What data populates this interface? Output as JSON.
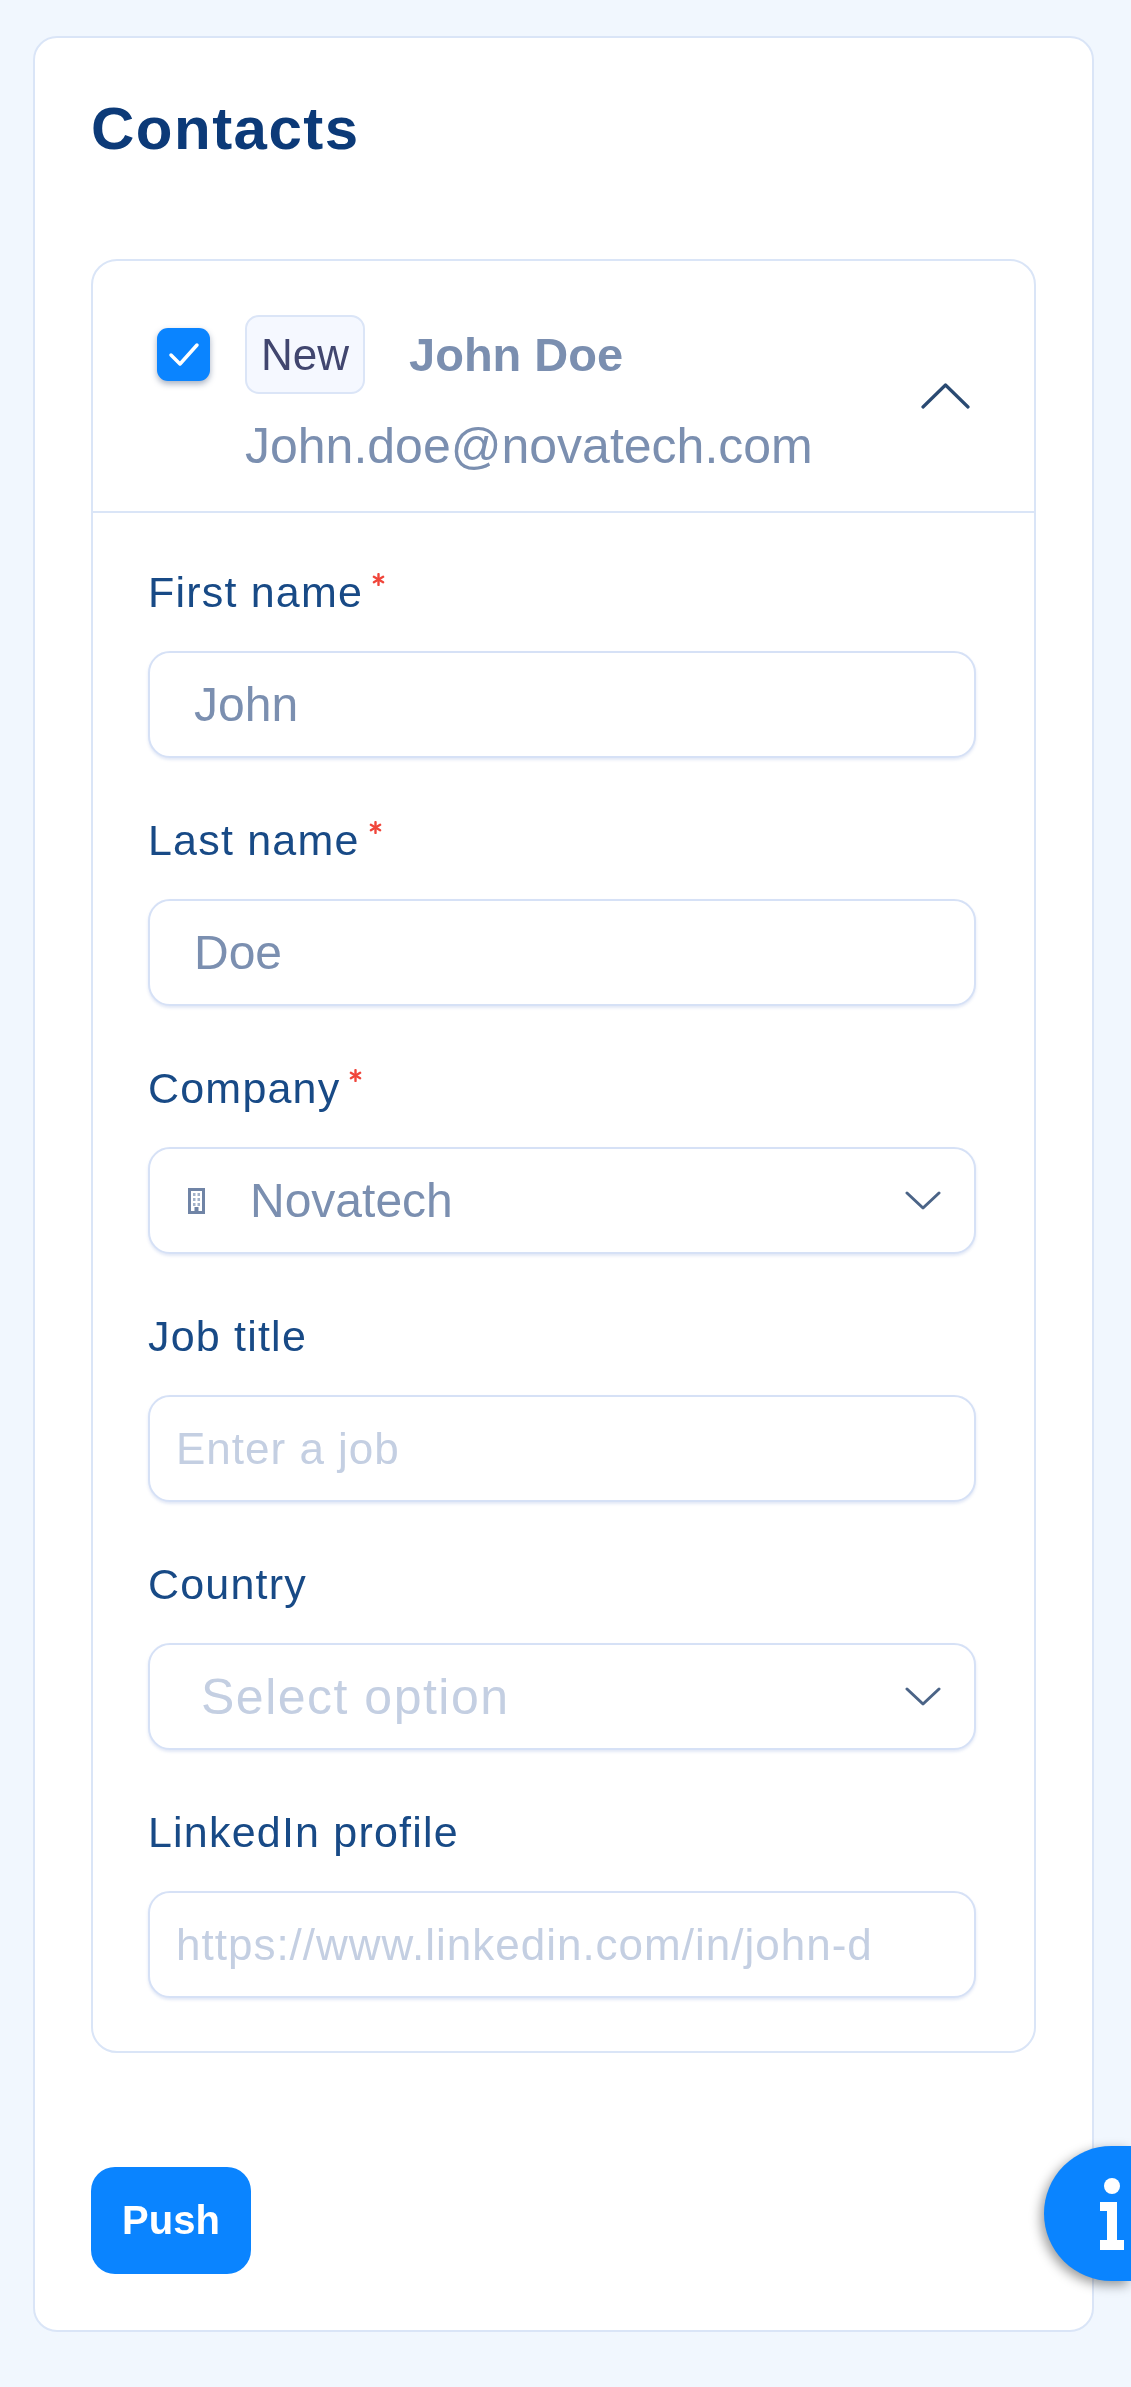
{
  "panel": {
    "title": "Contacts"
  },
  "contacts": [
    {
      "checked": true,
      "badge": "New",
      "name": "John Doe",
      "email": "John.doe@novatech.com",
      "expanded": true,
      "fields": [
        {
          "kind": "text",
          "label": "First name",
          "required": true,
          "value": "John"
        },
        {
          "kind": "text",
          "label": "Last name",
          "required": true,
          "value": "Doe"
        },
        {
          "kind": "lookup",
          "label": "Company",
          "required": true,
          "value": "Novatech"
        },
        {
          "kind": "text",
          "label": "Job title",
          "required": false,
          "placeholder": "Enter a job"
        },
        {
          "kind": "select",
          "label": "Country",
          "required": false,
          "placeholder": "Select option"
        },
        {
          "kind": "text",
          "label": "LinkedIn profile",
          "required": false,
          "placeholder": "https://www.linkedin.com/in/john-d"
        }
      ]
    }
  ],
  "push_button": {
    "label": "Push"
  }
}
